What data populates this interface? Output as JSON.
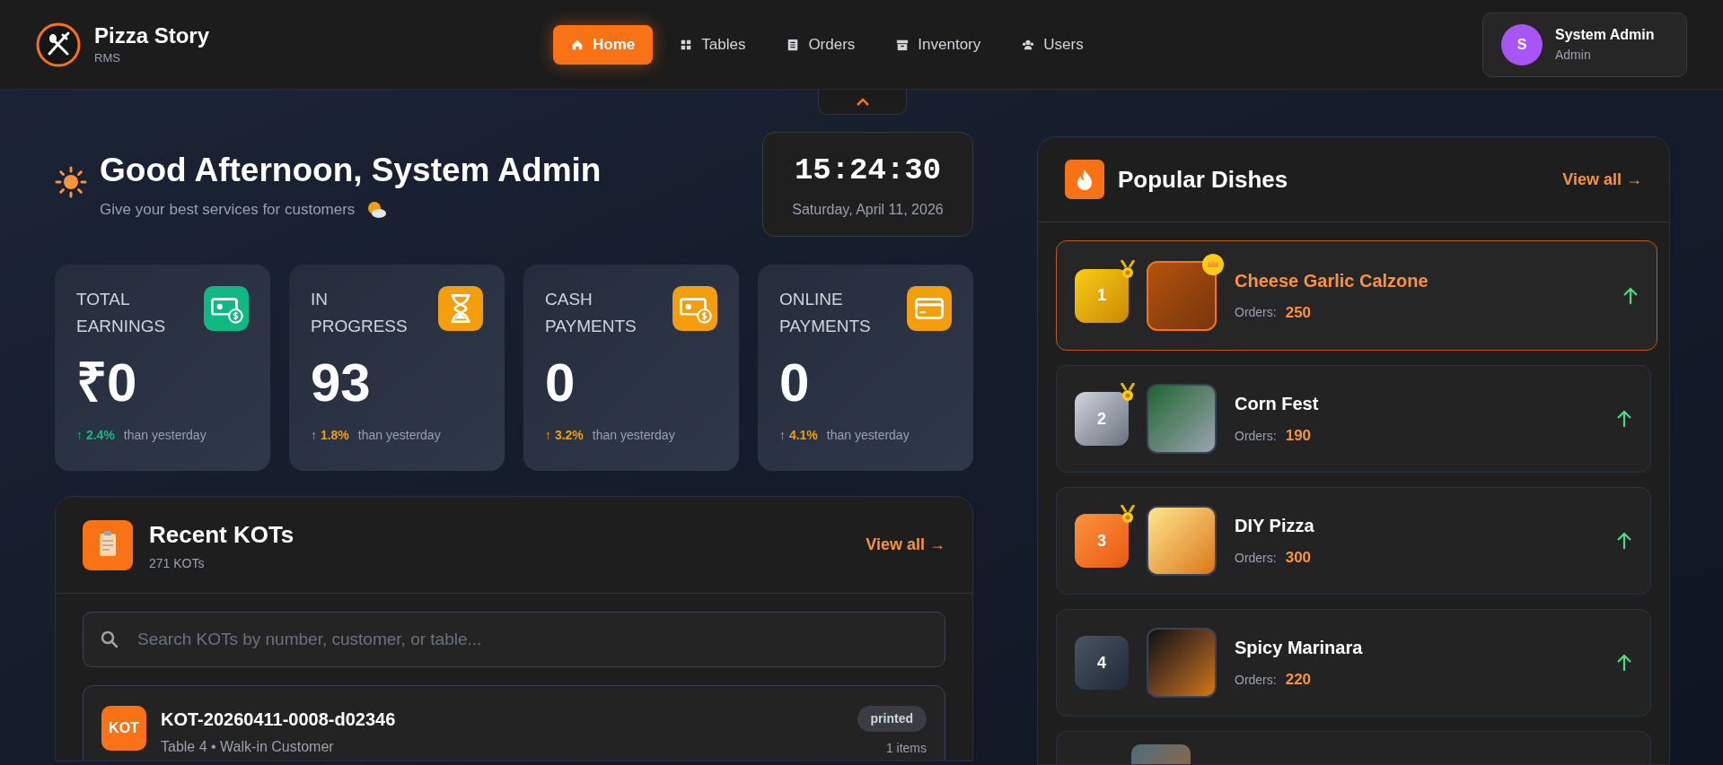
{
  "brand": {
    "name": "Pizza Story",
    "subtitle": "RMS"
  },
  "nav": [
    {
      "label": "Home",
      "kind": "home",
      "selected": true
    },
    {
      "label": "Tables",
      "kind": "tables",
      "selected": false
    },
    {
      "label": "Orders",
      "kind": "orders",
      "selected": false
    },
    {
      "label": "Inventory",
      "kind": "inventory",
      "selected": false
    },
    {
      "label": "Users",
      "kind": "users",
      "selected": false
    }
  ],
  "user": {
    "initial": "S",
    "name": "System Admin",
    "role": "Admin"
  },
  "greeting": {
    "title": "Good Afternoon, System Admin",
    "subtitle": "Give your best services for customers"
  },
  "clock": {
    "time": "15:24:30",
    "date": "Saturday, April 11, 2026"
  },
  "stats": [
    {
      "label": "TOTAL EARNINGS",
      "value": "₹0",
      "change": "↑ 2.4%",
      "note": "than yesterday",
      "kind": "money",
      "color": "#10b981"
    },
    {
      "label": "IN PROGRESS",
      "value": "93",
      "change": "↑ 1.8%",
      "note": "than yesterday",
      "kind": "hourglass",
      "color": "#f59e0b"
    },
    {
      "label": "CASH PAYMENTS",
      "value": "0",
      "change": "↑ 3.2%",
      "note": "than yesterday",
      "kind": "money",
      "color": "#f59e0b"
    },
    {
      "label": "ONLINE PAYMENTS",
      "value": "0",
      "change": "↑ 4.1%",
      "note": "than yesterday",
      "kind": "card",
      "color": "#f59e0b"
    }
  ],
  "kots": {
    "title": "Recent KOTs",
    "count": "271 KOTs",
    "view_all": "View all →",
    "search": {
      "placeholder": "Search KOTs by number, customer, or table..."
    },
    "rows": [
      {
        "badge": "KOT",
        "number": "KOT-20260411-0008-d02346",
        "detail": "Table 4 • Walk-in Customer",
        "status": "printed",
        "items": "1 items"
      }
    ]
  },
  "popular": {
    "title": "Popular Dishes",
    "view_all": "View all →",
    "dishes": [
      {
        "rank": "1",
        "kind": "gold",
        "name": "Cheese Garlic Calzone",
        "orders_label": "Orders:",
        "orders": "250",
        "highlighted": true,
        "medal": true,
        "crown": true
      },
      {
        "rank": "2",
        "kind": "silver",
        "name": "Corn Fest",
        "orders_label": "Orders:",
        "orders": "190",
        "highlighted": false,
        "medal": true,
        "crown": false
      },
      {
        "rank": "3",
        "kind": "bronze",
        "name": "DIY Pizza",
        "orders_label": "Orders:",
        "orders": "300",
        "highlighted": false,
        "medal": true,
        "crown": false
      },
      {
        "rank": "4",
        "kind": "plain",
        "name": "Spicy Marinara",
        "orders_label": "Orders:",
        "orders": "220",
        "highlighted": false,
        "medal": false,
        "crown": false
      },
      {
        "kind": "partial"
      }
    ]
  }
}
